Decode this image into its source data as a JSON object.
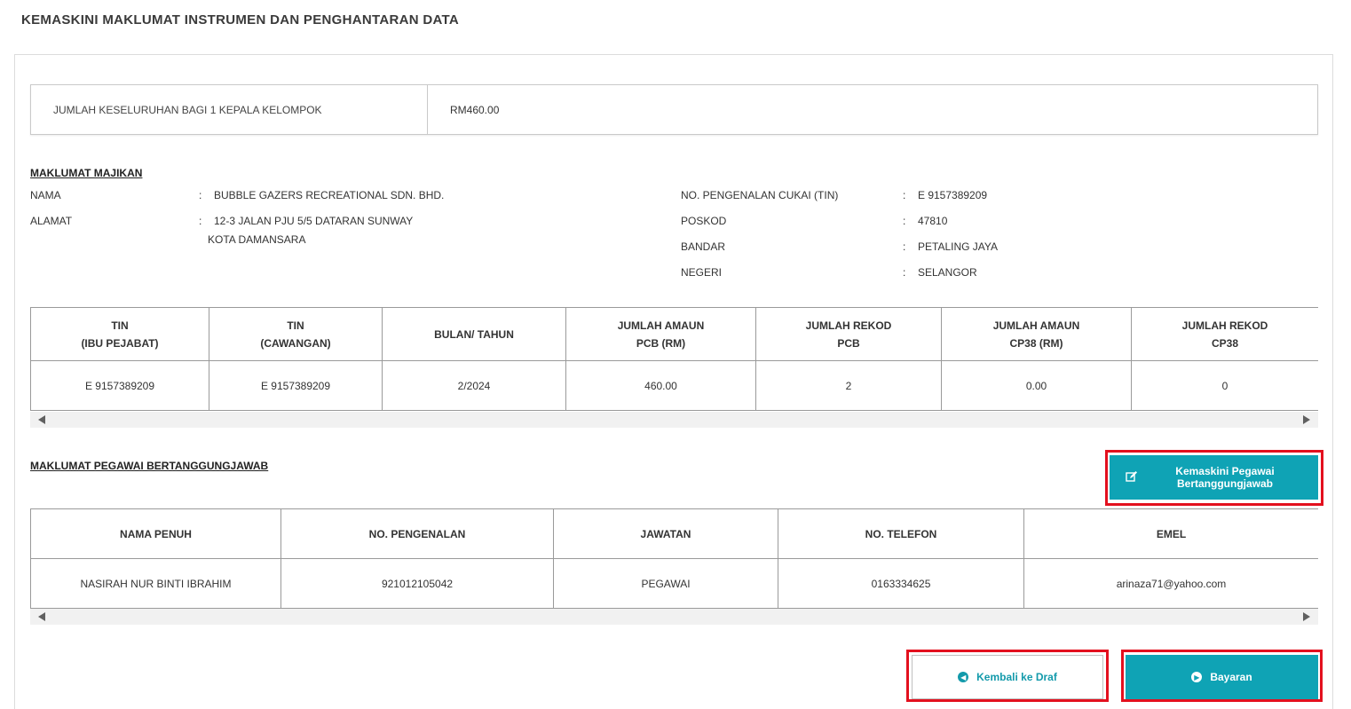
{
  "page_title": "KEMASKINI MAKLUMAT INSTRUMEN DAN PENGHANTARAN DATA",
  "summary": {
    "label": "JUMLAH KESELURUHAN BAGI 1 KEPALA KELOMPOK",
    "value": "RM460.00"
  },
  "employer": {
    "heading": "MAKLUMAT MAJIKAN",
    "colon": ":",
    "nama_label": "NAMA",
    "nama_value": "BUBBLE GAZERS RECREATIONAL SDN. BHD.",
    "alamat_label": "ALAMAT",
    "alamat_line1": "12-3 JALAN PJU 5/5 DATARAN SUNWAY",
    "alamat_line2": "KOTA DAMANSARA",
    "tin_label": "NO. PENGENALAN CUKAI (TIN)",
    "tin_value": "E 9157389209",
    "poskod_label": "POSKOD",
    "poskod_value": "47810",
    "bandar_label": "BANDAR",
    "bandar_value": "PETALING JAYA",
    "negeri_label": "NEGERI",
    "negeri_value": "SELANGOR"
  },
  "pcb_table": {
    "headers": [
      [
        "TIN",
        "(IBU PEJABAT)"
      ],
      [
        "TIN",
        "(CAWANGAN)"
      ],
      [
        "BULAN/ TAHUN",
        ""
      ],
      [
        "JUMLAH AMAUN",
        "PCB (RM)"
      ],
      [
        "JUMLAH REKOD",
        "PCB"
      ],
      [
        "JUMLAH AMAUN",
        "CP38 (RM)"
      ],
      [
        "JUMLAH REKOD",
        "CP38"
      ]
    ],
    "row": [
      "E 9157389209",
      "E 9157389209",
      "2/2024",
      "460.00",
      "2",
      "0.00",
      "0"
    ]
  },
  "officer": {
    "heading": "MAKLUMAT PEGAWAI BERTANGGUNGJAWAB",
    "update_button_line1": "Kemaskini Pegawai",
    "update_button_line2": "Bertanggungjawab",
    "headers": [
      "NAMA PENUH",
      "NO. PENGENALAN",
      "JAWATAN",
      "NO. TELEFON",
      "EMEL"
    ],
    "row": [
      "NASIRAH NUR BINTI IBRAHIM",
      "921012105042",
      "PEGAWAI",
      "0163334625",
      "arinaza71@yahoo.com"
    ]
  },
  "actions": {
    "back_label": "Kembali ke Draf",
    "pay_label": "Bayaran"
  },
  "colors": {
    "accent": "#0fa3b5",
    "highlight": "#e3101e"
  },
  "icons": {
    "edit": "edit-icon",
    "back": "circle-arrow-left-icon",
    "next": "circle-arrow-right-icon",
    "scroll_left": "scroll-left-arrow-icon",
    "scroll_right": "scroll-right-arrow-icon"
  }
}
